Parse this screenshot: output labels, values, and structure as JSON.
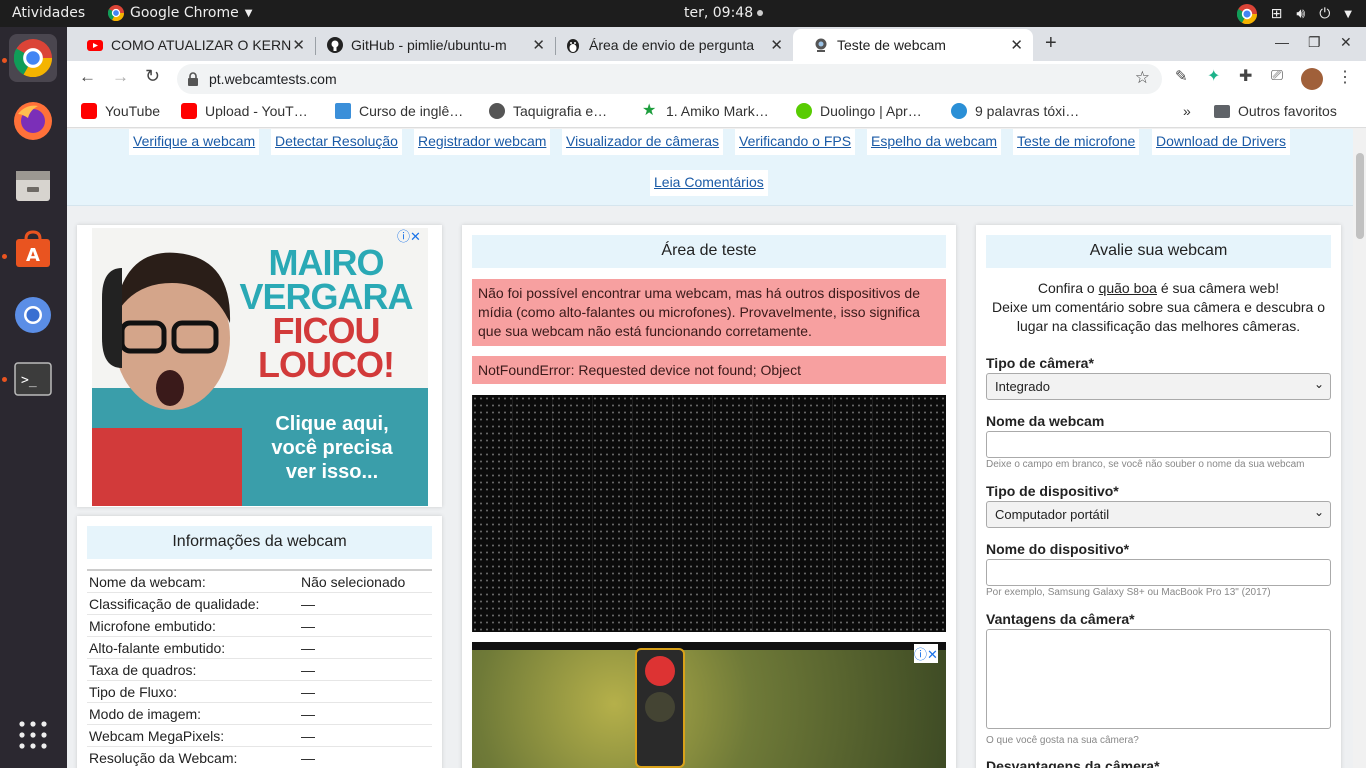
{
  "topbar": {
    "activities": "Atividades",
    "app_name": "Google Chrome",
    "clock": "ter, 09:48"
  },
  "tabs": [
    {
      "title": "COMO ATUALIZAR O KERN",
      "icon": "youtube-icon"
    },
    {
      "title": "GitHub - pimlie/ubuntu-m",
      "icon": "github-icon"
    },
    {
      "title": "Área de envio de pergunta",
      "icon": "askubuntu-icon"
    },
    {
      "title": "Teste de webcam",
      "icon": "webcam-icon"
    }
  ],
  "url": "pt.webcamtests.com",
  "bookmarks": [
    {
      "label": "YouTube",
      "icon": "youtube-icon",
      "color": "#ff0000"
    },
    {
      "label": "Upload - YouT…",
      "icon": "youtube-icon",
      "color": "#ff0000"
    },
    {
      "label": "Curso de inglê…",
      "icon": "course-icon",
      "color": "#3b8fd9"
    },
    {
      "label": "Taquigrafia e…",
      "icon": "globe-icon",
      "color": "#555555"
    },
    {
      "label": "1. Amiko Mark…",
      "icon": "star-icon",
      "color": "#1e9e3e"
    },
    {
      "label": "Duolingo | Apr…",
      "icon": "duolingo-icon",
      "color": "#58cc02"
    },
    {
      "label": "9 palavras tóxi…",
      "icon": "info-icon",
      "color": "#2a8fd6"
    }
  ],
  "bookmarks_more": "»",
  "other_bookmarks": "Outros favoritos",
  "nav": [
    "Verifique a webcam",
    "Detectar Resolução",
    "Registrador webcam",
    "Visualizador de câmeras",
    "Verificando o FPS",
    "Espelho da webcam",
    "Teste de microfone",
    "Download de Drivers",
    "Leia Comentários"
  ],
  "ad": {
    "line1": "MAIRO",
    "line2": "VERGARA",
    "line3": "FICOU",
    "line4": "LOUCO!",
    "cta1": "Clique aqui,",
    "cta2": "você precisa",
    "cta3": "ver isso..."
  },
  "info": {
    "title": "Informações da webcam",
    "rows": [
      {
        "k": "Nome da webcam:",
        "v": "Não selecionado"
      },
      {
        "k": "Classificação de qualidade:",
        "v": "—"
      },
      {
        "k": "Microfone embutido:",
        "v": "—"
      },
      {
        "k": "Alto-falante embutido:",
        "v": "—"
      },
      {
        "k": "Taxa de quadros:",
        "v": "—"
      },
      {
        "k": "Tipo de Fluxo:",
        "v": "—"
      },
      {
        "k": "Modo de imagem:",
        "v": "—"
      },
      {
        "k": "Webcam MegaPixels:",
        "v": "—"
      },
      {
        "k": "Resolução da Webcam:",
        "v": "—"
      }
    ]
  },
  "test": {
    "title": "Área de teste",
    "alert1": "Não foi possível encontrar uma webcam, mas há outros dispositivos de mídia (como alto-falantes ou microfones). Provavelmente, isso significa que sua webcam não está funcionando corretamente.",
    "alert2": "NotFoundError: Requested device not found; Object"
  },
  "rate": {
    "title": "Avalie sua webcam",
    "intro_pre": "Confira o ",
    "intro_link": "quão boa",
    "intro_post": " é sua câmera web!",
    "intro2": "Deixe um comentário sobre sua câmera e descubra o lugar na classificação das melhores câmeras.",
    "camera_type_label": "Tipo de câmera*",
    "camera_type_value": "Integrado",
    "webcam_name_label": "Nome da webcam",
    "webcam_name_hint": "Deixe o campo em branco, se você não souber o nome da sua webcam",
    "device_type_label": "Tipo de dispositivo*",
    "device_type_value": "Computador portátil",
    "device_name_label": "Nome do dispositivo*",
    "device_name_hint": "Por exemplo, Samsung Galaxy S8+ ou MacBook Pro 13\" (2017)",
    "pros_label": "Vantagens da câmera*",
    "pros_hint": "O que você gosta na sua câmera?",
    "cons_label": "Desvantagens da câmera*"
  }
}
